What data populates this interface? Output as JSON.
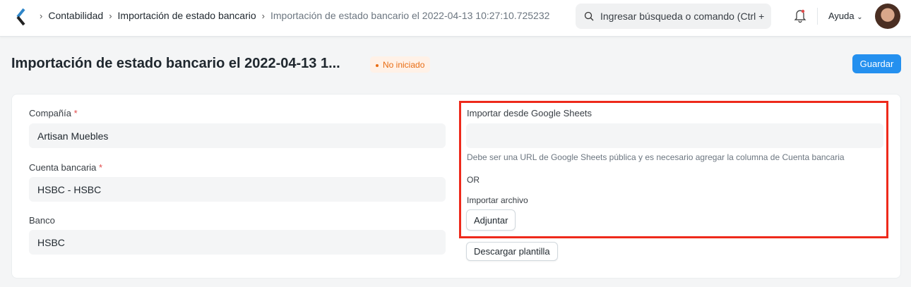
{
  "nav": {
    "breadcrumbs": [
      "Contabilidad",
      "Importación de estado bancario",
      "Importación de estado bancario el 2022-04-13 10:27:10.725232"
    ],
    "search_placeholder": "Ingresar búsqueda o comando (Ctrl +",
    "help_label": "Ayuda"
  },
  "page": {
    "title": "Importación de estado bancario el 2022-04-13 1...",
    "status": "No iniciado",
    "save_label": "Guardar"
  },
  "form": {
    "company": {
      "label": "Compañía",
      "value": "Artisan Muebles"
    },
    "bank_account": {
      "label": "Cuenta bancaria",
      "value": "HSBC - HSBC"
    },
    "bank": {
      "label": "Banco",
      "value": "HSBC"
    },
    "google_sheets": {
      "label": "Importar desde Google Sheets",
      "value": "",
      "description": "Debe ser una URL de Google Sheets pública y es necesario agregar la columna de Cuenta bancaria"
    },
    "or_text": "OR",
    "import_file": {
      "label": "Importar archivo",
      "attach_label": "Adjuntar"
    },
    "download_template_label": "Descargar plantilla"
  },
  "colors": {
    "accent": "#2490ef",
    "highlight": "#ee2a1b",
    "status": "#e86c13"
  }
}
